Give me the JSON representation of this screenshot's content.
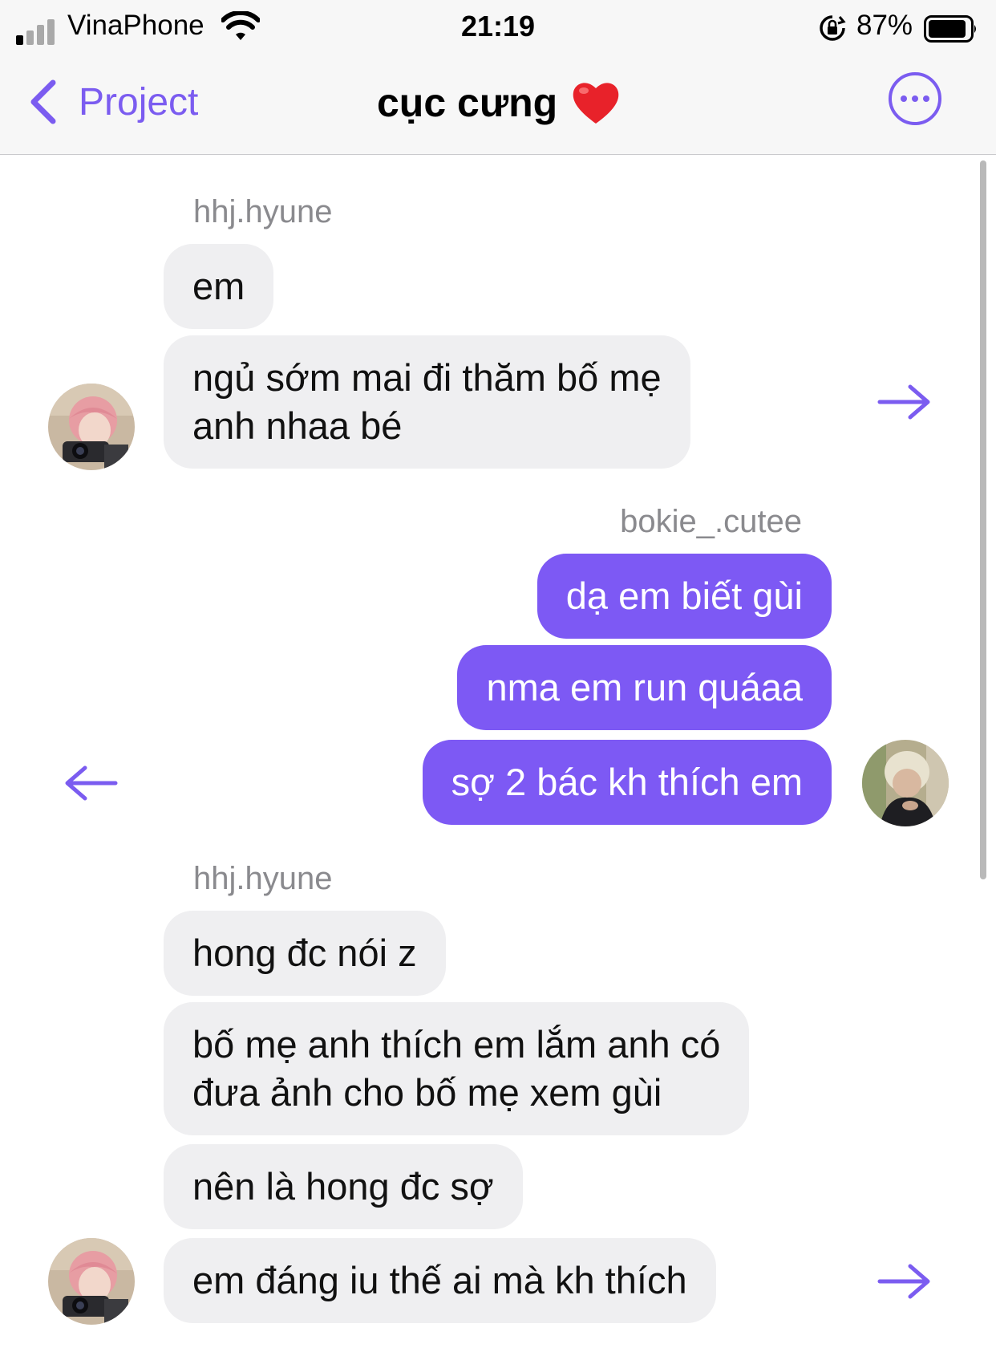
{
  "status_bar": {
    "carrier": "VinaPhone",
    "time": "21:19",
    "battery_percent": "87%"
  },
  "nav": {
    "back_label": "Project",
    "title": "cục cưng",
    "accent_color": "#7b5cf0"
  },
  "messages": {
    "group1": {
      "sender": "hhj.hyune",
      "m1": "em",
      "m2_line1": "ngủ sớm mai đi thăm bố mẹ",
      "m2_line2": "anh nhaa bé"
    },
    "group2": {
      "sender": "bokie_.cutee",
      "m1": "dạ em biết gùi",
      "m2": "nma em run quáaa",
      "m3": "sợ 2 bác kh thích em"
    },
    "group3": {
      "sender": "hhj.hyune",
      "m1": "hong đc nói z",
      "m2_line1": "bố mẹ anh thích em lắm anh có",
      "m2_line2": "đưa ảnh cho bố mẹ xem gùi",
      "m3": "nên là hong đc sợ",
      "m4": "em đáng iu thế ai mà kh thích"
    }
  },
  "colors": {
    "outgoing_bubble": "#7d59f4",
    "incoming_bubble": "#efeff1"
  }
}
